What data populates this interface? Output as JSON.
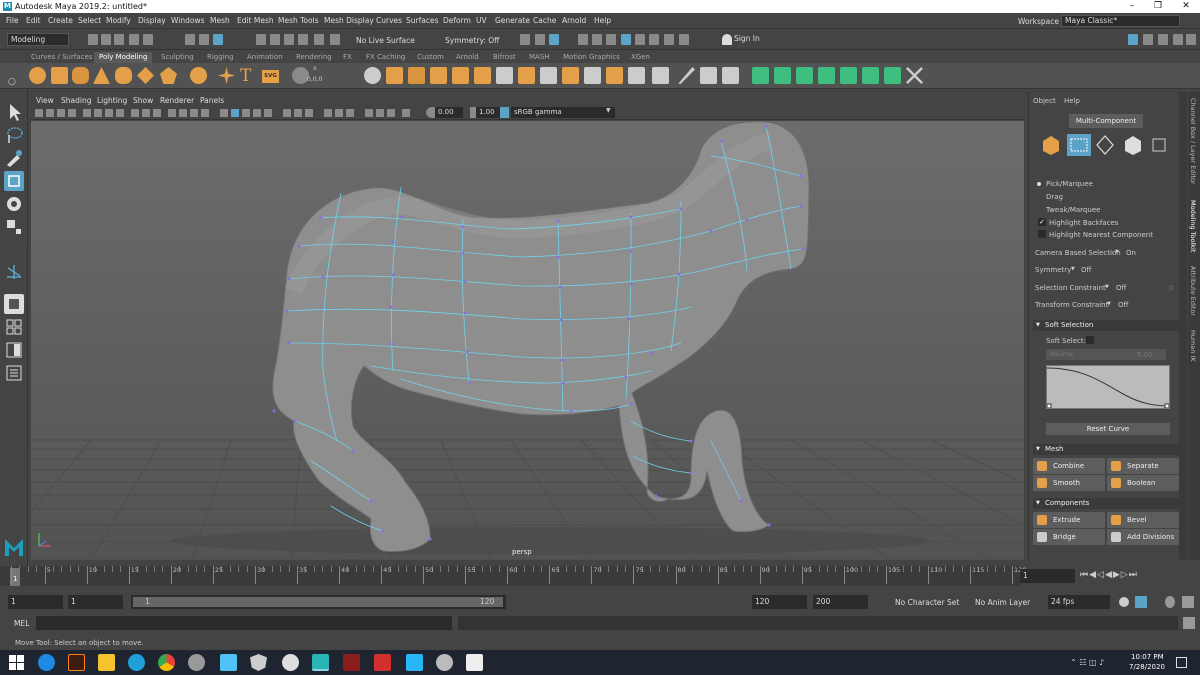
{
  "window": {
    "title": "Autodesk Maya 2019.2: untitled*",
    "logo": "M"
  },
  "menubar": {
    "items": [
      "File",
      "Edit",
      "Create",
      "Select",
      "Modify",
      "Display",
      "Windows",
      "Mesh",
      "Edit Mesh",
      "Mesh Tools",
      "Mesh Display",
      "Curves",
      "Surfaces",
      "Deform",
      "UV",
      "Generate",
      "Cache",
      "Arnold",
      "Help"
    ],
    "workspace_label": "Workspace :",
    "workspace_value": "Maya Classic*"
  },
  "statusline": {
    "mode": "Modeling",
    "live_surface": "No Live Surface",
    "symmetry": "Symmetry: Off",
    "sign_in": "Sign In"
  },
  "shelf": {
    "tabs": [
      "Curves / Surfaces",
      "Poly Modeling",
      "Sculpting",
      "Rigging",
      "Animation",
      "Rendering",
      "FX",
      "FX Caching",
      "Custom",
      "Arnold",
      "Bifrost",
      "MASH",
      "Motion Graphics",
      "XGen"
    ],
    "active_tab": "Poly Modeling",
    "text_icon_T": "T",
    "text_icon_svg": "SVG",
    "coords_label": "0,0,0"
  },
  "viewport": {
    "menus": [
      "View",
      "Shading",
      "Lighting",
      "Show",
      "Renderer",
      "Panels"
    ],
    "exposure": "0.00",
    "gamma": "1.00",
    "color_space": "sRGB gamma",
    "camera_label": "persp"
  },
  "right_panel": {
    "tabs": [
      "Object",
      "Help"
    ],
    "mode_title": "Multi-Component",
    "pick_options": [
      "Pick/Marquee",
      "Drag",
      "Tweak/Marquee"
    ],
    "checkboxes": [
      "Highlight Backfaces",
      "Highlight Nearest Component"
    ],
    "camera_based_selection_label": "Camera Based Selection",
    "camera_based_selection_value": "On",
    "symmetry_label": "Symmetry",
    "symmetry_value": "Off",
    "selection_constraint_label": "Selection Constraint",
    "selection_constraint_value": "Off",
    "selection_constraint_num": "0",
    "transform_constraint_label": "Transform Constraint",
    "transform_constraint_value": "Off",
    "soft_selection_header": "Soft Selection",
    "soft_select_label": "Soft Select:",
    "volume_label": "Volume",
    "volume_value": "5.00",
    "reset_curve": "Reset Curve",
    "mesh_header": "Mesh",
    "mesh_buttons": [
      "Combine",
      "Separate",
      "Smooth",
      "Boolean"
    ],
    "components_header": "Components",
    "component_buttons": [
      "Extrude",
      "Bevel",
      "Bridge",
      "Add Divisions"
    ]
  },
  "side_tabs": [
    "Channel Box / Layer Editor",
    "Modeling Toolkit",
    "Attribute Editor",
    "Human IK"
  ],
  "timeline": {
    "ticks": [
      "1",
      "5",
      "10",
      "15",
      "20",
      "25",
      "30",
      "35",
      "40",
      "45",
      "50",
      "55",
      "60",
      "65",
      "70",
      "75",
      "80",
      "85",
      "90",
      "95",
      "100",
      "105",
      "110",
      "115",
      "120"
    ],
    "current_frame": "1",
    "current_frame_box": "1"
  },
  "range": {
    "start": "1",
    "anim_start": "1",
    "slider_start": "1",
    "slider_end": "120",
    "end": "120",
    "anim_end": "200",
    "character_set": "No Character Set",
    "anim_layer": "No Anim Layer",
    "fps": "24 fps"
  },
  "commandline": {
    "lang": "MEL"
  },
  "helpline": {
    "text": "Move Tool: Select an object to move."
  },
  "taskbar": {
    "time": "10:07 PM",
    "date": "7/28/2020"
  }
}
